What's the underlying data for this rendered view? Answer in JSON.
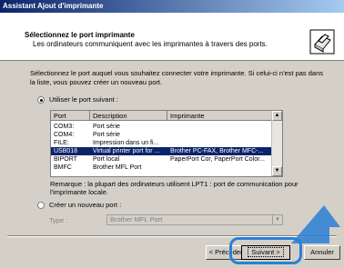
{
  "window": {
    "title": "Assistant Ajout d'imprimante"
  },
  "header": {
    "title": "Sélectionnez le port imprimante",
    "description": "Les ordinateurs communiquent avec les imprimantes à travers des ports."
  },
  "instructions": "Sélectionnez le port auquel vous souhaitez connecter votre imprimante. Si celui-ci n'est pas dans la liste, vous pouvez créer un nouveau port.",
  "option_existing": {
    "label": "Utiliser le port suivant :",
    "selected": true
  },
  "port_list": {
    "columns": [
      "Port",
      "Description",
      "Imprimante"
    ],
    "rows": [
      {
        "port": "COM3:",
        "description": "Port série",
        "printer": ""
      },
      {
        "port": "COM4:",
        "description": "Port série",
        "printer": ""
      },
      {
        "port": "FILE:",
        "description": "Impression dans un fi...",
        "printer": ""
      },
      {
        "port": "USB018",
        "description": "Virtual printer port for ...",
        "printer": "Brother PC-FAX, Brother MFC-..."
      },
      {
        "port": "BIPORT",
        "description": "Port local",
        "printer": "PaperPort Cor, PaperPort Color..."
      },
      {
        "port": "BMFC",
        "description": "Brother MFL Port",
        "printer": ""
      }
    ],
    "selected_row": 3
  },
  "remark": "Remarque : la plupart des ordinateurs utilisent LPT1 : port de communication pour l'imprimante locale.",
  "option_new": {
    "label": "Créer un nouveau port :",
    "selected": false
  },
  "port_type": {
    "label": "Type :",
    "value": "Brother MFL Port"
  },
  "buttons": {
    "back": "< Précédent",
    "next": "Suivant >",
    "cancel": "Annuler"
  },
  "colors": {
    "title_bar": "#0a246a",
    "selection": "#0a246a",
    "highlight": "#2b7fd6"
  },
  "icons": {
    "header": "printer-icon",
    "pointer": "arrow-pointer-icon"
  }
}
